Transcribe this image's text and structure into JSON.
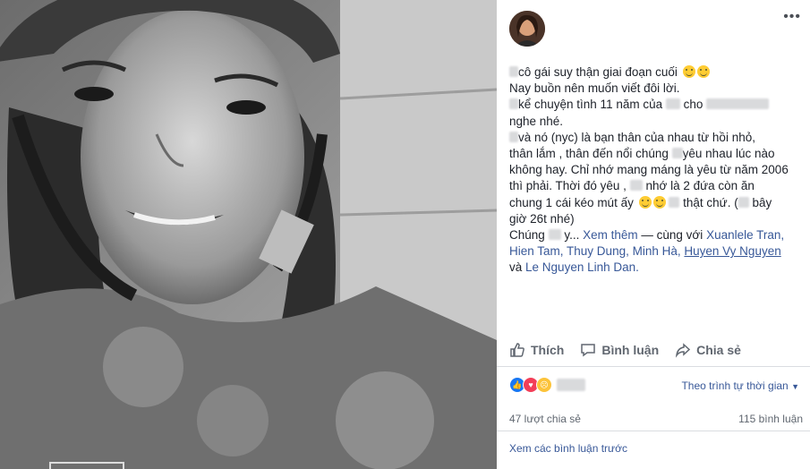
{
  "post": {
    "line1": "cô gái suy thận giai đoạn cuối",
    "line2": "Nay buồn nên muốn viết đôi lời.",
    "line3a": "kể chuyện tình 11 năm của",
    "line3b": "cho",
    "line4": "nghe nhé.",
    "line5a": "và nó (nyc) là bạn thân của nhau từ hồi nhỏ,",
    "line6a": "thân lắm , thân đến nổi chúng",
    "line6b": "yêu nhau lúc nào",
    "line7": "không hay. Chỉ nhớ mang máng là yêu từ năm 2006",
    "line8a": "thì phải. Thời đó yêu ,",
    "line8b": "nhớ là 2 đứa còn ăn",
    "line9a": "chung 1 cái kéo mút ấy",
    "line9b": "thật chứ. (",
    "line9c": "bây",
    "line10": "giờ 26t nhé)",
    "line11a": "Chúng",
    "line11b": "y...",
    "see_more": "Xem thêm",
    "with_text": "— cùng với",
    "tag1": "Xuanlele Tran,",
    "tag2": "Hien Tam,",
    "tag3": "Thuy Dung,",
    "tag4": "Minh Hà,",
    "tag5": "Huyen Vy Nguyen",
    "and_text": "và",
    "tag6": "Le Nguyen Linh Dan."
  },
  "actions": {
    "like": "Thích",
    "comment": "Bình luận",
    "share": "Chia sẻ"
  },
  "reactions": {
    "sort_label": "Theo trình tự thời gian"
  },
  "stats": {
    "shares": "47 lượt chia sẻ",
    "comments": "115 bình luận"
  },
  "comments": {
    "view_previous": "Xem các bình luận trước"
  },
  "colors": {
    "link": "#385898",
    "like_blue": "#1877f2",
    "love_red": "#f33e58",
    "sad_yellow": "#fcc33a"
  }
}
